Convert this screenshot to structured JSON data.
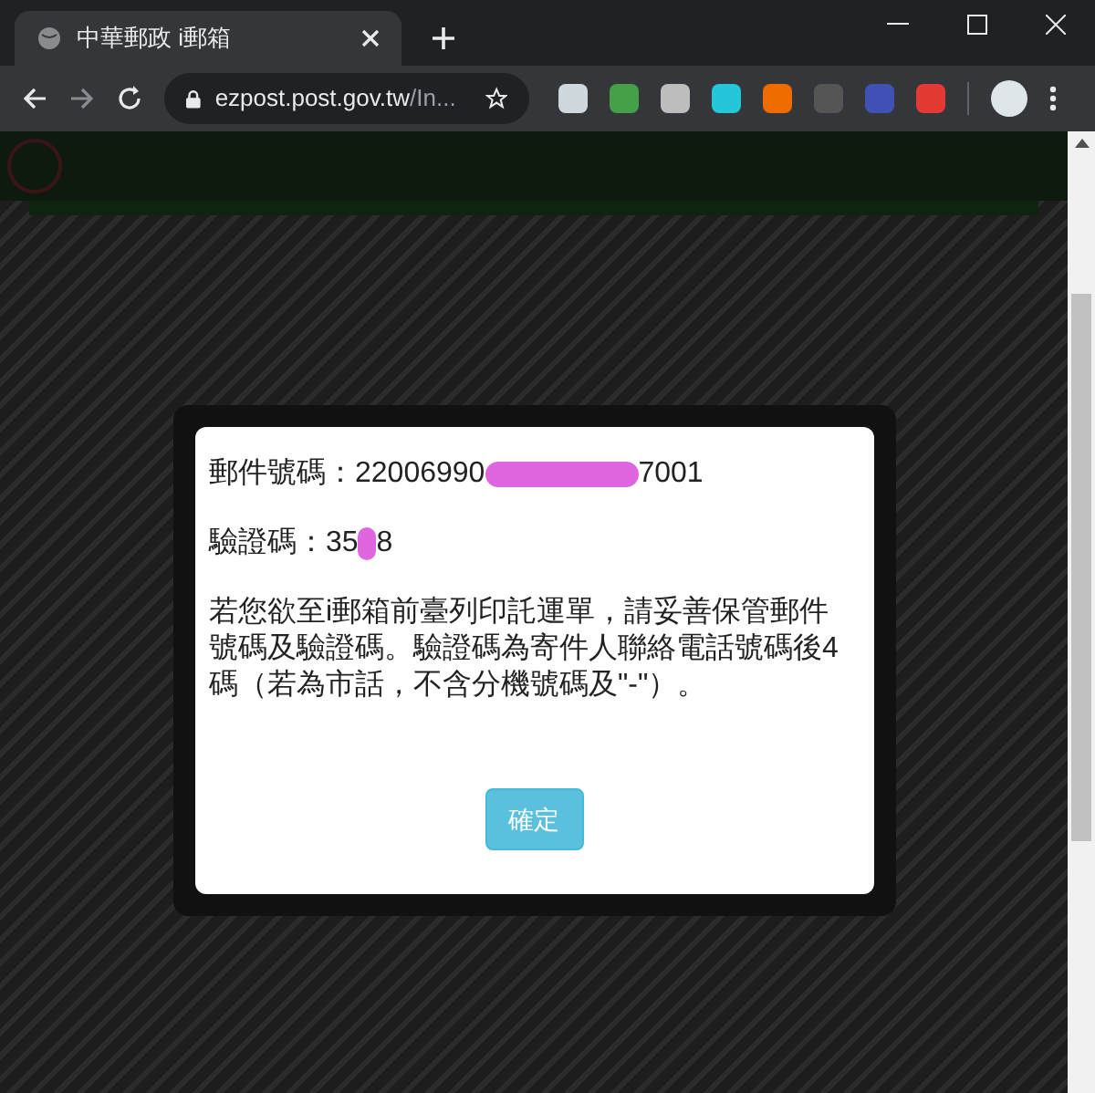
{
  "browser": {
    "tab": {
      "title": "中華郵政 i郵箱",
      "selected": true
    },
    "url_host": "ezpost.post.gov.tw",
    "url_rest": "/In...",
    "extensions": [
      {
        "color": "#cfd8dc"
      },
      {
        "color": "#43a047"
      },
      {
        "color": "#bdbdbd"
      },
      {
        "color": "#26c6da"
      },
      {
        "color": "#ef6c00"
      },
      {
        "color": "#555555"
      },
      {
        "color": "#3f51b5"
      },
      {
        "color": "#e53935"
      }
    ]
  },
  "dialog": {
    "tracking_label": "郵件號碼：",
    "tracking_start": "22006990",
    "tracking_end": "7001",
    "code_label": "驗證碼：",
    "code_start": "35",
    "code_end": "8",
    "notice": "若您欲至i郵箱前臺列印託運單，請妥善保管郵件號碼及驗證碼。驗證碼為寄件人聯絡電話號碼後4碼（若為市話，不含分機號碼及\"-\"）。",
    "button": "確定"
  }
}
